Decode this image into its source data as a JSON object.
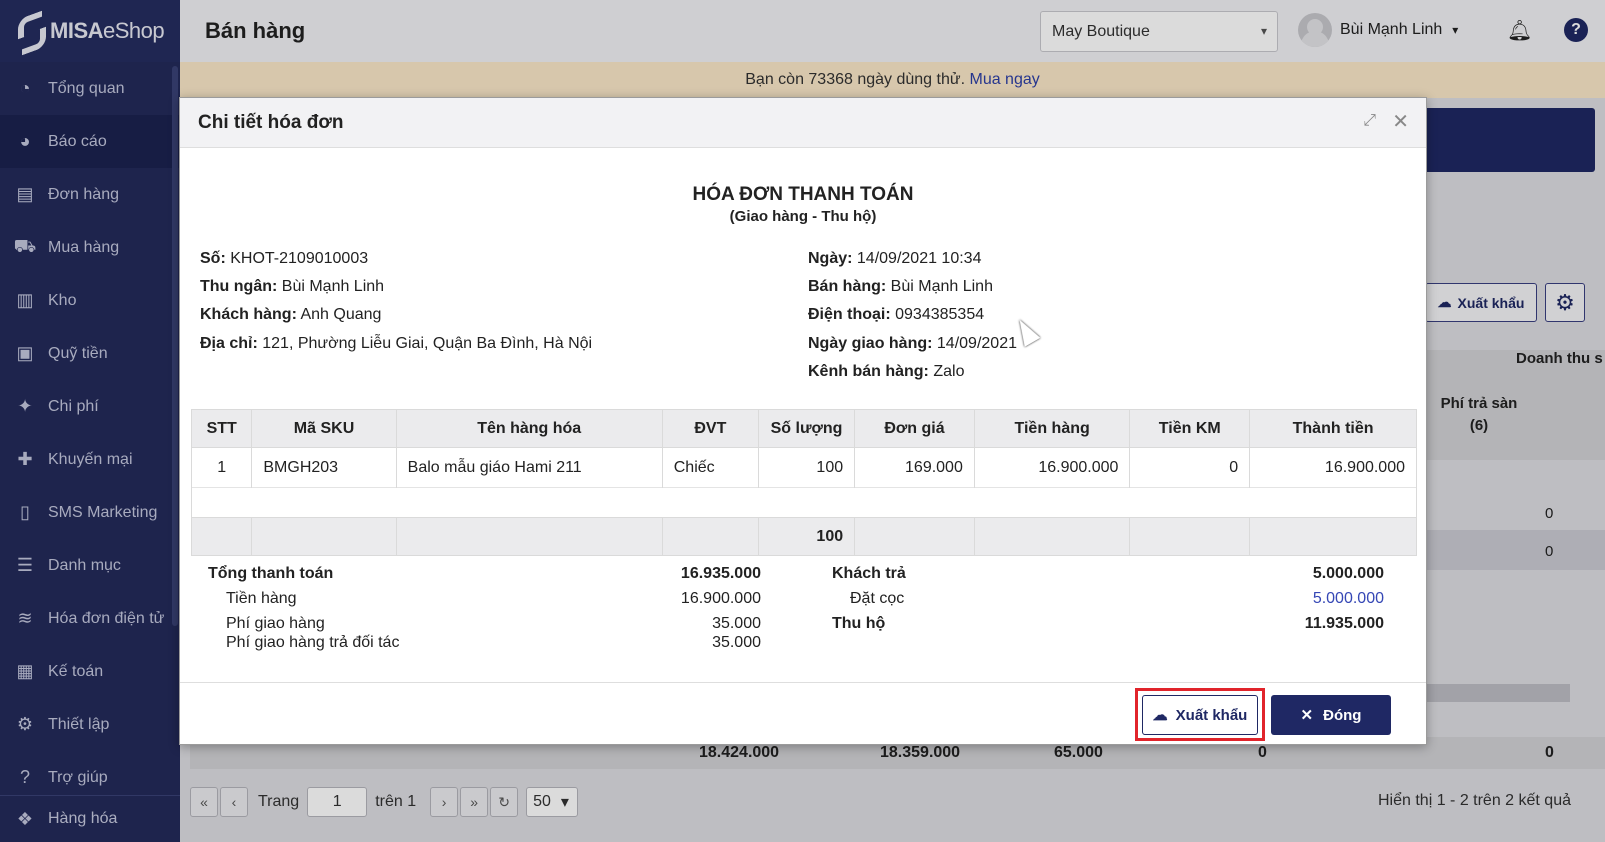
{
  "app": {
    "logo_brand": "MISA",
    "logo_product": "eShop",
    "page_title": "Bán hàng"
  },
  "sidebar": {
    "items": [
      {
        "label": "Tổng quan",
        "icon": "dashboard-icon"
      },
      {
        "label": "Báo cáo",
        "icon": "pie-chart-icon"
      },
      {
        "label": "Đơn hàng",
        "icon": "order-icon"
      },
      {
        "label": "Mua hàng",
        "icon": "cart-icon"
      },
      {
        "label": "Kho",
        "icon": "warehouse-icon"
      },
      {
        "label": "Quỹ tiền",
        "icon": "safe-icon"
      },
      {
        "label": "Chi phí",
        "icon": "expense-icon"
      },
      {
        "label": "Khuyến mại",
        "icon": "gift-icon"
      },
      {
        "label": "SMS Marketing",
        "icon": "phone-icon"
      },
      {
        "label": "Danh mục",
        "icon": "list-icon"
      },
      {
        "label": "Hóa đơn điện tử",
        "icon": "einvoice-icon"
      },
      {
        "label": "Kế toán",
        "icon": "calculator-icon"
      },
      {
        "label": "Thiết lập",
        "icon": "gear-icon"
      },
      {
        "label": "Trợ giúp",
        "icon": "help-icon"
      }
    ],
    "bottom_item": "Hàng hóa"
  },
  "header": {
    "store": "May Boutique",
    "user_name": "Bùi Mạnh Linh"
  },
  "trial": {
    "text": "Bạn còn 73368 ngày dùng thử.",
    "link": "Mua ngay"
  },
  "background": {
    "export_label": "Xuất khẩu",
    "col_doanh_thu": "Doanh thu s",
    "col_phi_tra_san": "Phí trả sàn",
    "col_phi_tra_san_index": "(6)",
    "row_values": [
      "0",
      "0"
    ],
    "totals": [
      "18.424.000",
      "18.359.000",
      "65.000",
      "0",
      "0"
    ],
    "pager": {
      "page_label": "Trang",
      "page": "1",
      "of_label": "trên 1",
      "page_size": "50",
      "result": "Hiển thị 1 - 2 trên 2 kết quả"
    }
  },
  "modal": {
    "title": "Chi tiết hóa đơn",
    "invoice_title": "HÓA ĐƠN THANH TOÁN",
    "invoice_subtitle": "(Giao hàng - Thu hộ)",
    "left_info": [
      {
        "label": "Số:",
        "value": "KHOT-2109010003"
      },
      {
        "label": "Thu ngân:",
        "value": "Bùi Mạnh Linh"
      },
      {
        "label": "Khách hàng:",
        "value": "Anh Quang"
      },
      {
        "label": "Địa chỉ:",
        "value": "121, Phường Liễu Giai, Quận Ba Đình, Hà Nội"
      }
    ],
    "right_info": [
      {
        "label": "Ngày:",
        "value": "14/09/2021 10:34"
      },
      {
        "label": "Bán hàng:",
        "value": "Bùi Mạnh Linh"
      },
      {
        "label": "Điện thoại:",
        "value": "0934385354"
      },
      {
        "label": "Ngày giao hàng:",
        "value": "14/09/2021"
      },
      {
        "label": "Kênh bán hàng:",
        "value": "Zalo"
      }
    ],
    "table": {
      "headers": [
        "STT",
        "Mã SKU",
        "Tên hàng hóa",
        "ĐVT",
        "Số lượng",
        "Đơn giá",
        "Tiền hàng",
        "Tiền KM",
        "Thành tiền"
      ],
      "rows": [
        [
          "1",
          "BMGH203",
          "Balo mẫu giáo Hami 211",
          "Chiếc",
          "100",
          "169.000",
          "16.900.000",
          "0",
          "16.900.000"
        ]
      ],
      "total_quantity": "100"
    },
    "summary": {
      "tong_thanh_toan_label": "Tổng thanh toán",
      "tong_thanh_toan": "16.935.000",
      "tien_hang_label": "Tiền hàng",
      "tien_hang": "16.900.000",
      "phi_giao_hang_label": "Phí giao hàng",
      "phi_giao_hang": "35.000",
      "phi_doi_tac_label": "Phí giao hàng trả đối tác",
      "phi_doi_tac": "35.000",
      "khach_tra_label": "Khách trả",
      "khach_tra": "5.000.000",
      "dat_coc_label": "Đặt cọc",
      "dat_coc": "5.000.000",
      "thu_ho_label": "Thu hộ",
      "thu_ho": "11.935.000"
    },
    "buttons": {
      "export": "Xuất khẩu",
      "close": "Đóng"
    }
  }
}
